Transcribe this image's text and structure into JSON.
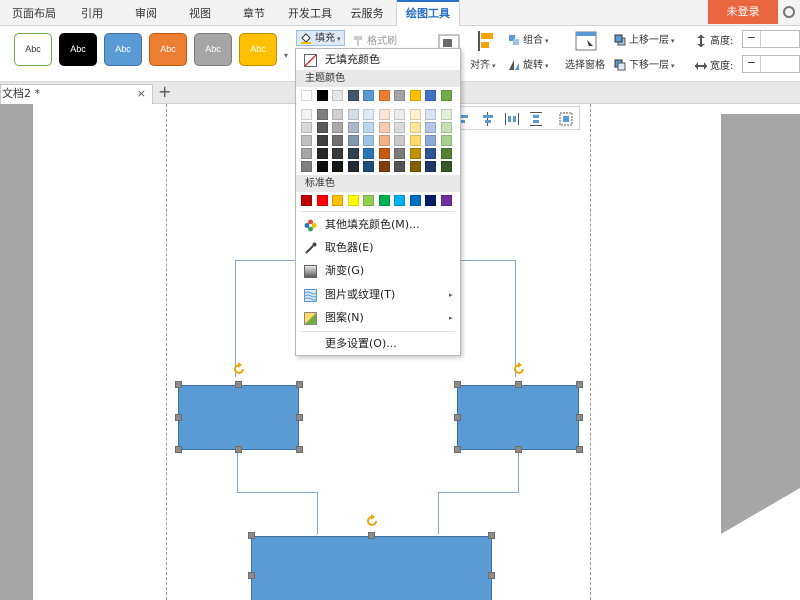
{
  "menu": {
    "tabs": [
      "页面布局",
      "引用",
      "审阅",
      "视图",
      "章节",
      "开发工具",
      "云服务",
      "绘图工具"
    ],
    "active_tab": "绘图工具",
    "login": "未登录"
  },
  "ribbon": {
    "shape_styles": [
      {
        "label": "Abc",
        "bg": "#ffffff",
        "border": "#70ad47",
        "fg": "#333333"
      },
      {
        "label": "Abc",
        "bg": "#000000",
        "border": "#000000",
        "fg": "#ffffff"
      },
      {
        "label": "Abc",
        "bg": "#5b9bd5",
        "border": "#41719c",
        "fg": "#ffffff"
      },
      {
        "label": "Abc",
        "bg": "#ed7d31",
        "border": "#c55a11",
        "fg": "#ffffff"
      },
      {
        "label": "Abc",
        "bg": "#a5a5a5",
        "border": "#7f7f7f",
        "fg": "#ffffff"
      },
      {
        "label": "Abc",
        "bg": "#ffc000",
        "border": "#bf9000",
        "fg": "#ffffff"
      }
    ],
    "fill": "填充",
    "format_painter": "格式刷",
    "align": "对齐",
    "group": "组合",
    "rotate": "旋转",
    "selection_pane": "选择窗格",
    "bring_forward": "上移一层",
    "send_backward": "下移一层",
    "height_label": "高度:",
    "width_label": "宽度:",
    "minus": "−"
  },
  "document": {
    "tab_title": "文档2 *",
    "close": "×",
    "new_tab": "+"
  },
  "fill_menu": {
    "no_fill": "无填充颜色",
    "theme_colors": "主题颜色",
    "standard_colors": "标准色",
    "more_fill_colors": "其他填充颜色(M)...",
    "eyedropper": "取色器(E)",
    "gradient": "渐变(G)",
    "picture_texture": "图片或纹理(T)",
    "pattern": "图案(N)",
    "more_settings": "更多设置(O)...",
    "theme_top": [
      "#ffffff",
      "#000000",
      "#e7e6e6",
      "#44546a",
      "#5b9bd5",
      "#ed7d31",
      "#a5a5a5",
      "#ffc000",
      "#4472c4",
      "#70ad47"
    ],
    "theme_shades": [
      [
        "#f2f2f2",
        "#7f7f7f",
        "#d0cece",
        "#d6dce4",
        "#deebf6",
        "#fbe5d5",
        "#ededed",
        "#fff2cc",
        "#dae3f3",
        "#e2efd9"
      ],
      [
        "#d8d8d8",
        "#595959",
        "#aeaaaa",
        "#adb9ca",
        "#bdd7ee",
        "#f7cbac",
        "#dbdbdb",
        "#fee599",
        "#b4c6e7",
        "#c5e0b3"
      ],
      [
        "#bfbfbf",
        "#3f3f3f",
        "#757070",
        "#8496b0",
        "#9dc3e6",
        "#f4b183",
        "#c9c9c9",
        "#ffd965",
        "#8eaadb",
        "#a8d08d"
      ],
      [
        "#a5a5a5",
        "#262626",
        "#3a3838",
        "#323f4f",
        "#2e75b5",
        "#c55a11",
        "#7b7b7b",
        "#bf9000",
        "#2f5496",
        "#538135"
      ],
      [
        "#7f7f7f",
        "#0c0c0c",
        "#171616",
        "#222a35",
        "#1e4e79",
        "#833c0b",
        "#525252",
        "#7f6000",
        "#1f3864",
        "#375623"
      ]
    ],
    "standard": [
      "#c00000",
      "#ff0000",
      "#ffc000",
      "#ffff00",
      "#92d050",
      "#00b050",
      "#00b0f0",
      "#0070c0",
      "#002060",
      "#7030a0"
    ]
  },
  "colors": {
    "accent": "#2b70c9",
    "login_bg": "#e9663f",
    "shape_fill": "#5b9bd5",
    "connector": "#7fa9d1",
    "rotate_handle": "#f0a30a"
  }
}
